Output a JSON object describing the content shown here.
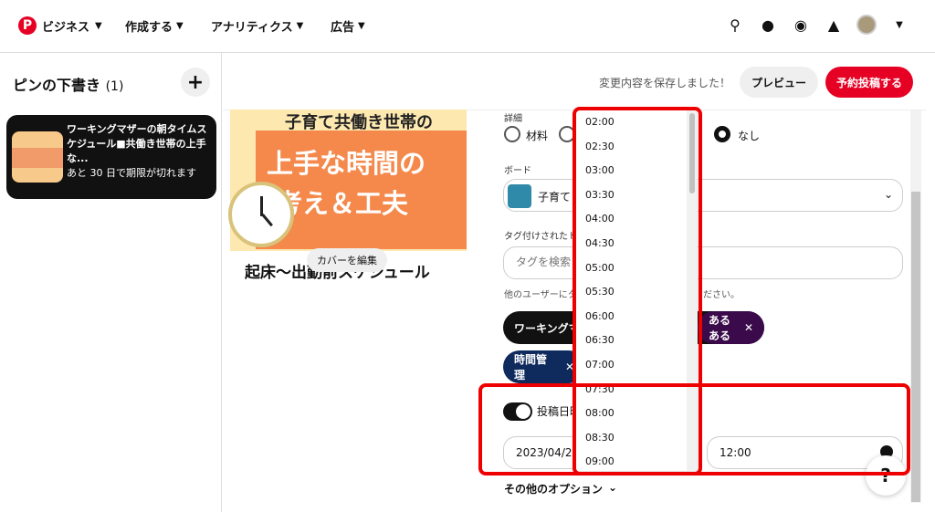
{
  "topnav": {
    "brand": "ビジネス",
    "items": [
      "作成する",
      "アナリティクス",
      "広告"
    ]
  },
  "left_panel": {
    "title": "ピンの下書き",
    "count": "(1)",
    "draft": {
      "title": "ワーキングマザーの朝タイムスケジュール■共働き世帯の上手な...",
      "subtitle": "あと 30 日で期限が切れます"
    }
  },
  "savebar": {
    "message": "変更内容を保存しました！",
    "preview": "プレビュー",
    "publish": "予約投稿する"
  },
  "pin": {
    "line1": "子育て共働き世帯の",
    "line2": "上手な時間の",
    "line3": "考え＆工夫",
    "line4": "起床〜出勤前スケジュール",
    "cover_edit": "カバーを編集"
  },
  "form": {
    "details_label": "詳細",
    "radio_material": "材料",
    "radio_none": "なし",
    "board_label": "ボード",
    "board_value": "子育て",
    "tag_label": "タグ付けされたト",
    "tag_placeholder": "タグを検索",
    "tag_hint_left": "他のユーザーにタ",
    "tag_hint_right": "ださい。",
    "chip1": "ワーキングマ",
    "chip1_tail": "あるある",
    "chip2": "時間管理",
    "schedule_label": "投稿日時",
    "date": "2023/04/23",
    "time": "12:00",
    "more_options": "その他のオプション"
  },
  "time_dropdown": {
    "options": [
      "02:00",
      "02:30",
      "03:00",
      "03:30",
      "04:00",
      "04:30",
      "05:00",
      "05:30",
      "06:00",
      "06:30",
      "07:00",
      "07:30",
      "08:00",
      "08:30",
      "09:00"
    ]
  },
  "help": "?",
  "colors": {
    "accent": "#e60023",
    "highlight": "#ee0000"
  }
}
